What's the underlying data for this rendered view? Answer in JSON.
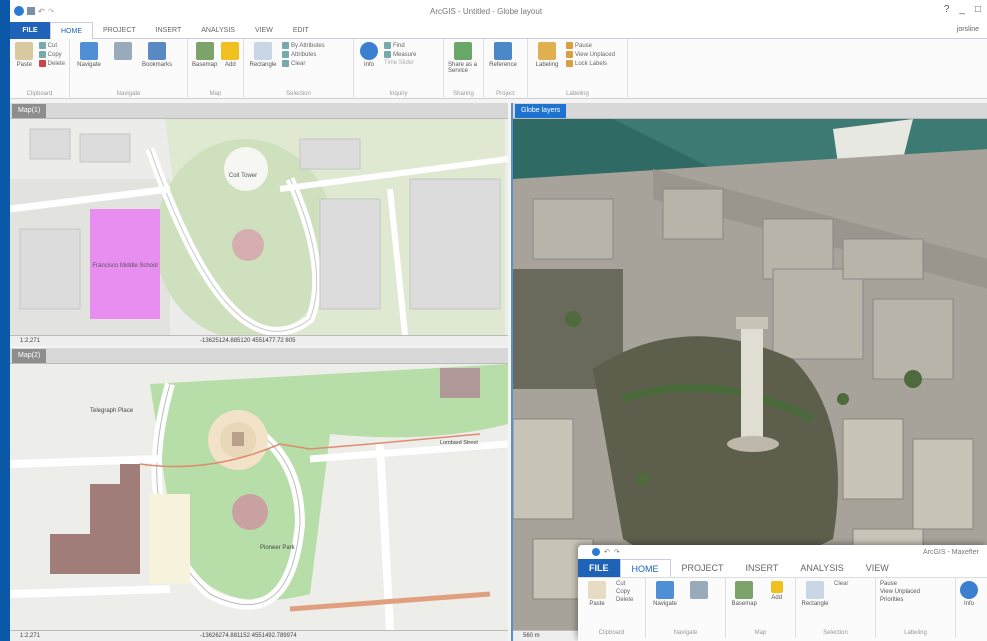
{
  "app": {
    "title": "ArcGIS - Untitled - Globe layout",
    "user": "jorsline"
  },
  "tabs": [
    "FILE",
    "HOME",
    "PROJECT",
    "INSERT",
    "ANALYSIS",
    "VIEW",
    "EDIT"
  ],
  "ribbon": {
    "clipboard": {
      "label": "Clipboard",
      "paste": "Paste",
      "cut": "Cut",
      "copy": "Copy",
      "delete": "Delete"
    },
    "navigate": {
      "label": "Navigate",
      "explore": "Navigate",
      "bookmarks": "Bookmarks"
    },
    "map": {
      "label": "Map",
      "basemap": "Basemap",
      "add": "Add"
    },
    "selection": {
      "label": "Selection",
      "rectangle": "Rectangle",
      "by_attr": "By Attributes",
      "attr": "Attributes",
      "clear": "Clear"
    },
    "inquiry": {
      "label": "Inquiry",
      "info": "Info",
      "find": "Find",
      "measure": "Measure",
      "time": "Time Slider"
    },
    "sharing": {
      "label": "Sharing",
      "share": "Share as a Service"
    },
    "project": {
      "label": "Project",
      "reference": "Reference"
    },
    "labeling": {
      "label": "Labeling",
      "labeling": "Labeling",
      "pause": "Pause",
      "view_unplaced": "View Unplaced",
      "lock": "Lock Labels"
    }
  },
  "maps": {
    "top": {
      "tab": "Map(1)",
      "scale": "1:2,271",
      "coords": "-13625124.885120  4551477.72 805"
    },
    "bottom": {
      "tab": "Map(2)",
      "scale": "1:2,271",
      "coords": "-13626274.881152  4551492.789974"
    },
    "globe": {
      "tab": "Globe layers",
      "scale": "560 m"
    },
    "labels": {
      "tower": "Coit Tower",
      "park": "Pioneer Park",
      "street1": "Telegraph Place",
      "street2": "Lombard Street",
      "school": "Francisco Middle School"
    }
  },
  "inset": {
    "title": "ArcGIS - Maxefter",
    "tabs": [
      "FILE",
      "HOME",
      "PROJECT",
      "INSERT",
      "ANALYSIS",
      "VIEW"
    ],
    "items": {
      "paste": "Paste",
      "cut": "Cut",
      "copy": "Copy",
      "delete": "Delete",
      "explore": "Navigate",
      "basemap": "Basemap",
      "add": "Add",
      "rectangle": "Rectangle",
      "clear": "Clear",
      "pause": "Pause",
      "view_unplaced": "View Unplaced",
      "priorities": "Priorities",
      "info": "Info"
    },
    "groups": [
      "Clipboard",
      "Navigate",
      "Map",
      "Selection",
      "Labeling"
    ]
  }
}
